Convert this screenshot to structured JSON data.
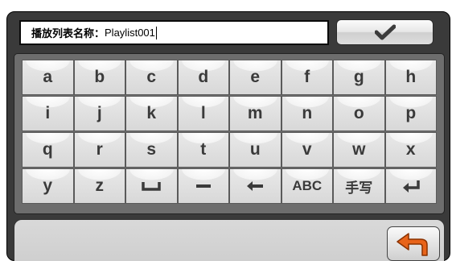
{
  "input": {
    "label": "播放列表名称：",
    "value": "Playlist001"
  },
  "confirm_icon": "checkmark-icon",
  "keyboard": {
    "rows": [
      [
        "a",
        "b",
        "c",
        "d",
        "e",
        "f",
        "g",
        "h"
      ],
      [
        "i",
        "j",
        "k",
        "l",
        "m",
        "n",
        "o",
        "p"
      ],
      [
        "q",
        "r",
        "s",
        "t",
        "u",
        "v",
        "w",
        "x"
      ],
      [
        "y",
        "z",
        "␣",
        "−",
        "←",
        "ABC",
        "手写",
        "↵"
      ]
    ],
    "special_key_icons": {
      "space": "space-bar-icon",
      "minus": "minus-icon",
      "backspace": "left-arrow-icon",
      "enter": "enter-return-icon"
    }
  },
  "back_icon": "back-arrow-icon",
  "colors": {
    "back_arrow": "#e8641a",
    "frame": "#3a3a3a",
    "keyboard_bg": "#6d6d6d"
  }
}
